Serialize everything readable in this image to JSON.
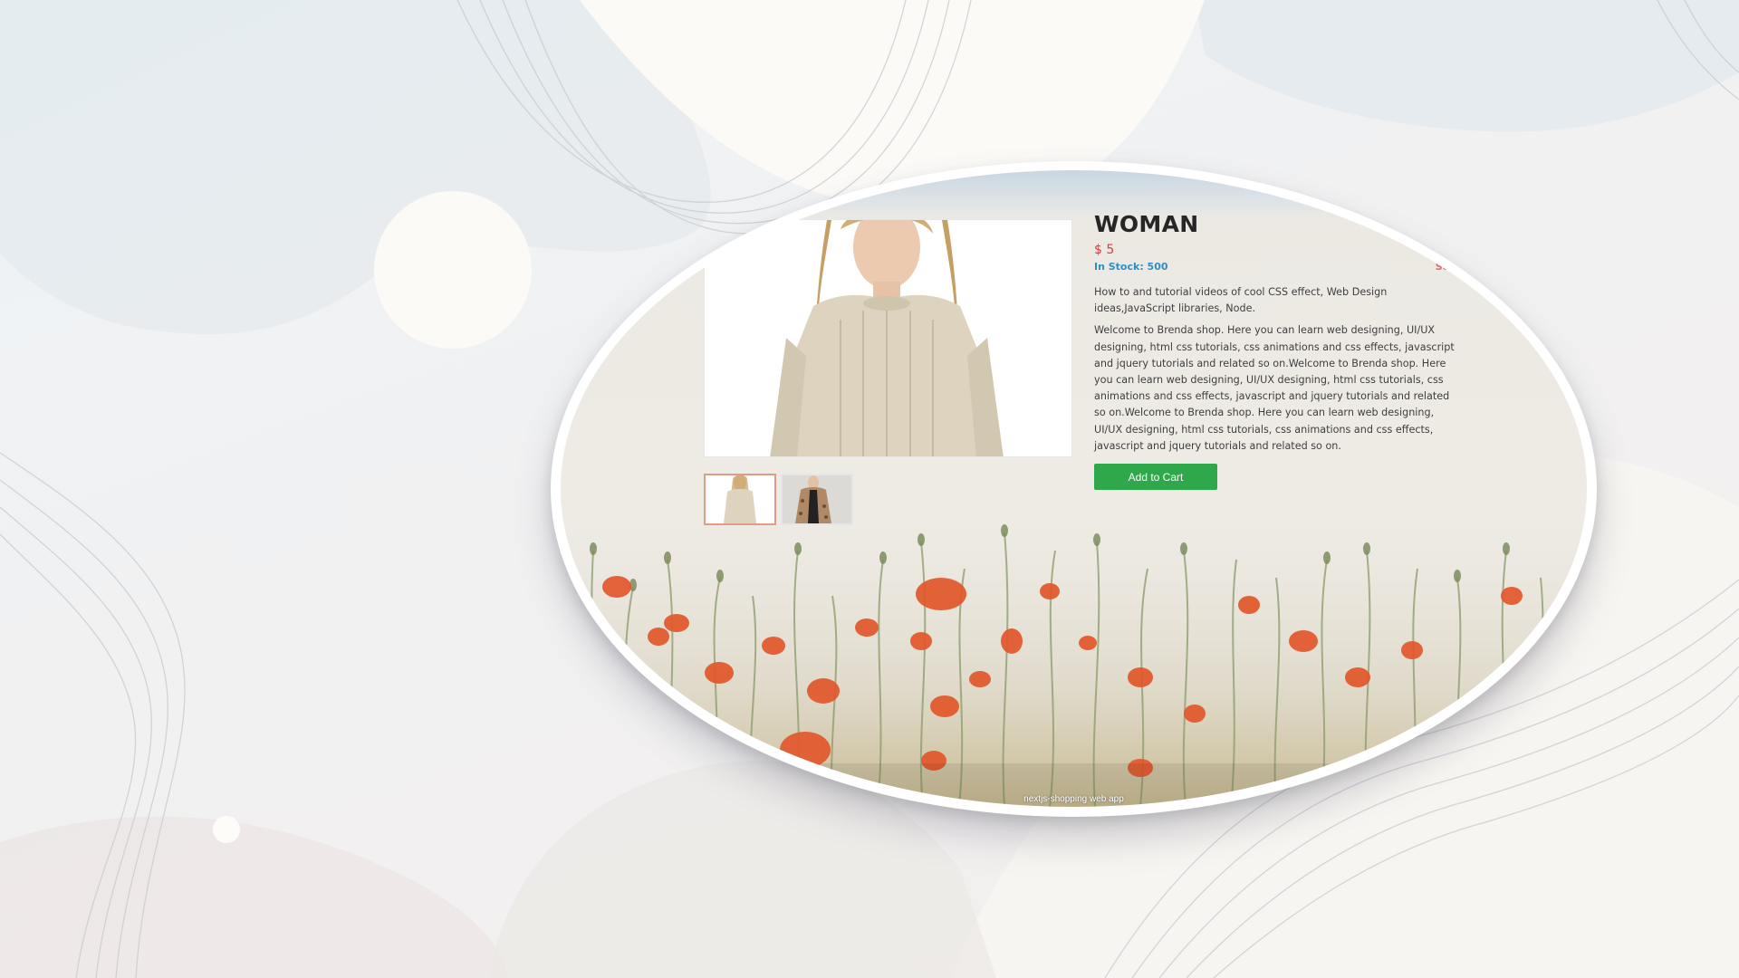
{
  "product": {
    "title": "WOMAN",
    "price": "$ 5",
    "stock": "In Stock: 500",
    "sold": "Sold.",
    "description_short": "How to and tutorial videos of cool CSS effect, Web Design ideas,JavaScript libraries, Node.",
    "description_long": "Welcome to Brenda shop. Here you can learn web designing, UI/UX designing, html css tutorials, css animations and css effects, javascript and jquery tutorials and related so on.Welcome to Brenda shop. Here you can learn web designing, UI/UX designing, html css tutorials, css animations and css effects, javascript and jquery tutorials and related so on.Welcome to Brenda shop. Here you can learn web designing, UI/UX designing, html css tutorials, css animations and css effects, javascript and jquery tutorials and related so on.",
    "add_to_cart_label": "Add to Cart",
    "images": [
      {
        "name": "woman-cream-sweater",
        "selected": true
      },
      {
        "name": "woman-leopard-coat",
        "selected": false
      }
    ]
  },
  "footer": {
    "app_name": "nextjs-shopping web app"
  },
  "colors": {
    "price": "#d93c3c",
    "stock": "#2f8fbe",
    "sold": "#d96b6b",
    "cart_button": "#2ea84a",
    "active_thumb_border": "#e49a85"
  }
}
